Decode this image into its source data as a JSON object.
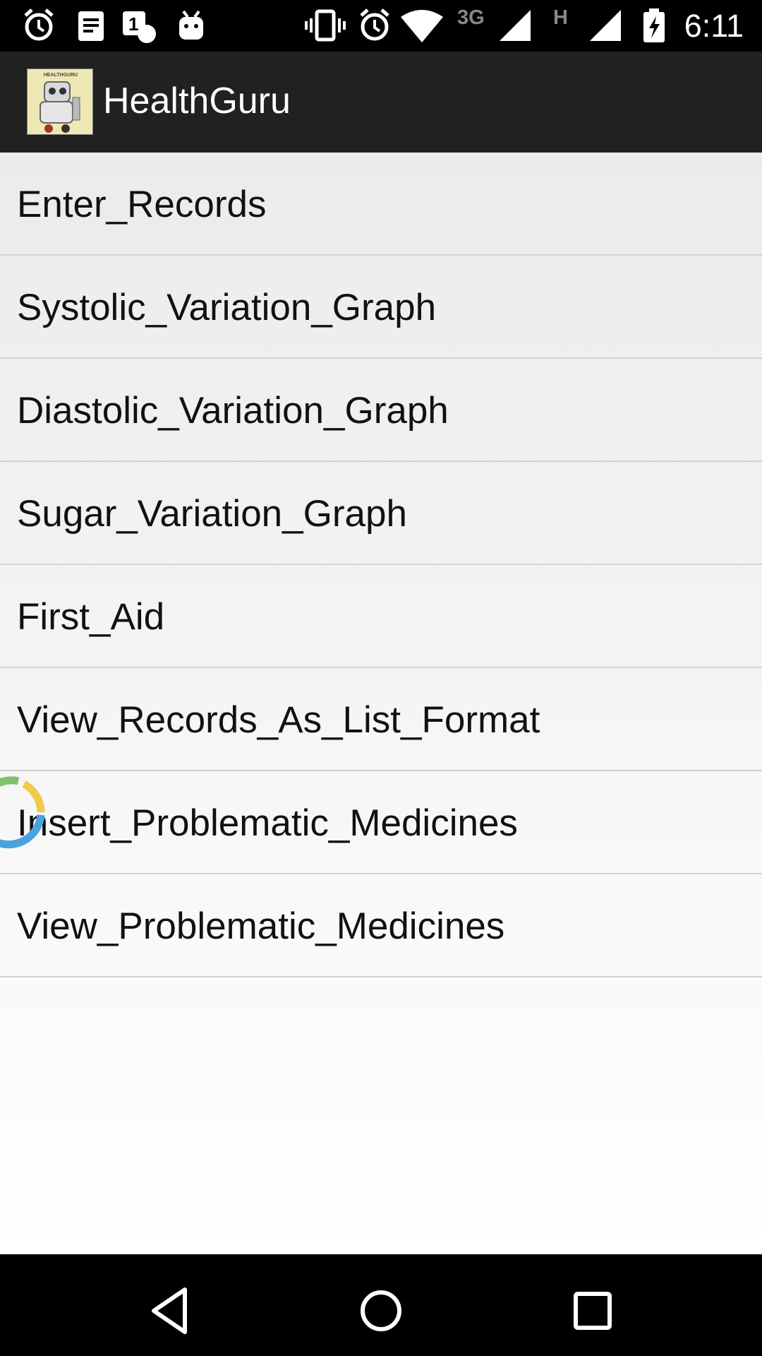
{
  "status_bar": {
    "time": "6:11",
    "network_3g": "3G",
    "network_h": "H",
    "icons": [
      "alarm-icon",
      "notes-icon",
      "notification-icon",
      "android-icon",
      "vibrate-icon",
      "alarm-icon",
      "wifi-icon",
      "signal-icon",
      "signal-icon",
      "battery-charging-icon"
    ]
  },
  "app": {
    "title": "HealthGuru",
    "logo_text": "HEALTHGURU"
  },
  "menu": {
    "items": [
      {
        "label": "Enter_Records"
      },
      {
        "label": "Systolic_Variation_Graph"
      },
      {
        "label": "Diastolic_Variation_Graph"
      },
      {
        "label": "Sugar_Variation_Graph"
      },
      {
        "label": "First_Aid"
      },
      {
        "label": "View_Records_As_List_Format"
      },
      {
        "label": "Insert_Problematic_Medicines"
      },
      {
        "label": "View_Problematic_Medicines"
      }
    ]
  },
  "nav_bar": {
    "icons": [
      "back-icon",
      "home-icon",
      "recents-icon"
    ]
  },
  "colors": {
    "action_bar": "#212121",
    "status_bar": "#000000",
    "divider": "#d2d2d2",
    "spinner": [
      "#f2c94c",
      "#4aa3df",
      "#7cc36b"
    ]
  }
}
